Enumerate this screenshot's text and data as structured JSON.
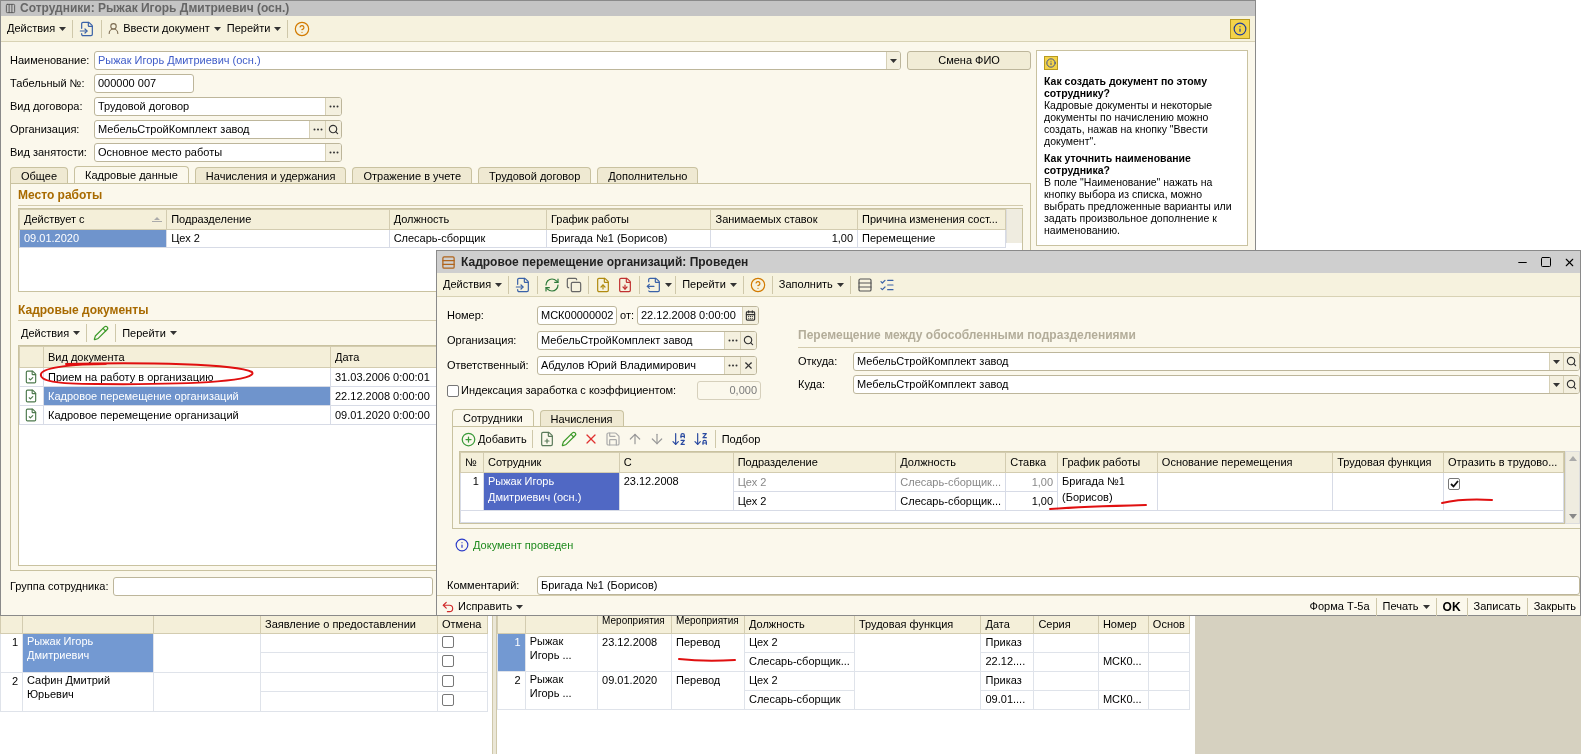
{
  "employee_window": {
    "title": "Сотрудники: Рыжак Игорь Дмитриевич (осн.)",
    "toolbar": {
      "actions": "Действия",
      "enter_document": "Ввести документ",
      "go": "Перейти"
    },
    "fields": [
      {
        "kind": "name",
        "label": "Наименование:",
        "value": "Рыжак Игорь Дмитриевич (осн.)"
      },
      {
        "kind": "plain",
        "label": "Табельный №:",
        "value": "000000 007"
      },
      {
        "kind": "select",
        "label": "Вид договора:",
        "value": "Трудовой договор"
      },
      {
        "kind": "lookup",
        "label": "Организация:",
        "value": "МебельСтройКомплект завод"
      },
      {
        "kind": "select",
        "label": "Вид занятости:",
        "value": "Основное место работы"
      }
    ],
    "rename_button": "Смена ФИО",
    "tabs": [
      {
        "label": "Общее",
        "selected": false
      },
      {
        "label": "Кадровые данные",
        "selected": true
      },
      {
        "label": "Начисления и удержания",
        "selected": false
      },
      {
        "label": "Отражение в учете",
        "selected": false
      },
      {
        "label": "Трудовой договор",
        "selected": false
      },
      {
        "label": "Дополнительно",
        "selected": false
      }
    ],
    "workplace": {
      "title": "Место работы",
      "columns": [
        "Действует с",
        "Подразделение",
        "Должность",
        "График работы",
        "Занимаемых ставок",
        "Причина изменения сост..."
      ],
      "rows": [
        {
          "selected": true,
          "cells": [
            "09.01.2020",
            "Цех 2",
            "Слесарь-сборщик",
            "Бригада №1 (Борисов)",
            "1,00",
            "Перемещение"
          ]
        }
      ]
    },
    "hr_documents": {
      "title": "Кадровые документы",
      "toolbar": {
        "actions": "Действия",
        "go": "Перейти"
      },
      "columns": [
        "Вид документа",
        "Дата"
      ],
      "rows": [
        {
          "type": "Прием на работу в организацию",
          "date": "31.03.2006 0:00:01",
          "selected": false
        },
        {
          "type": "Кадровое перемещение организаций",
          "date": "22.12.2008 0:00:00",
          "selected": true
        },
        {
          "type": "Кадровое перемещение организаций",
          "date": "09.01.2020 0:00:00",
          "selected": false
        }
      ]
    },
    "group_field": {
      "label": "Группа сотрудника:"
    },
    "help": [
      {
        "question": "Как создать документ по этому сотруднику?",
        "answer": "Кадровые документы и некоторые документы по начислению можно создать, нажав на кнопку \"Ввести документ\"."
      },
      {
        "question": "Как уточнить наименование сотрудника?",
        "answer": "В поле \"Наименование\" нажать на кнопку выбора из списка, можно выбрать предложенные варианты или задать произвольное дополнение к наименованию."
      }
    ]
  },
  "transfer_window": {
    "title": "Кадровое перемещение организаций: Проведен",
    "toolbar": {
      "actions": "Действия",
      "go": "Перейти",
      "fill": "Заполнить"
    },
    "number": {
      "label": "Номер:",
      "value": "МСК00000002",
      "date_label": "от:",
      "date": "22.12.2008  0:00:00"
    },
    "organization": {
      "label": "Организация:",
      "value": "МебельСтройКомплект завод"
    },
    "responsible": {
      "label": "Ответственный:",
      "value": "Абдулов Юрий Владимирович"
    },
    "indexation": {
      "label": "Индексация заработка с коэффициентом:",
      "checked": false,
      "value": "0,000"
    },
    "heading": "Перемещение между обособленными подразделениями",
    "from": {
      "label": "Откуда:",
      "value": "МебельСтройКомплект завод"
    },
    "to": {
      "label": "Куда:",
      "value": "МебельСтройКомплект завод"
    },
    "tabs": [
      {
        "label": "Сотрудники",
        "selected": true
      },
      {
        "label": "Начисления",
        "selected": false
      }
    ],
    "table_toolbar": {
      "add": "Добавить",
      "pick": "Подбор"
    },
    "table": {
      "columns": [
        "№",
        "Сотрудник",
        "С",
        "Подразделение",
        "Должность",
        "Ставка",
        "График работы",
        "Основание перемещения",
        "Трудовая функция",
        "Отразить в трудово..."
      ],
      "rows": [
        {
          "number": "1",
          "employee": "Рыжак Игорь Дмитриевич (осн.)",
          "selected": true,
          "date": "23.12.2008",
          "old_department": "Цех 2",
          "new_department": "Цех 2",
          "old_position": "Слесарь-сборщик...",
          "new_position": "Слесарь-сборщик...",
          "old_rate": "1,00",
          "new_rate": "1,00",
          "schedule": "Бригада №1 (Борисов)",
          "record_in_workbook": true
        }
      ]
    },
    "status": "Документ проведен",
    "comment": {
      "label": "Комментарий:",
      "value": "Бригада №1 (Борисов)"
    },
    "footer": {
      "fix": "Исправить",
      "form": "Форма Т-5а",
      "print": "Печать",
      "ok": "OK",
      "save": "Записать",
      "close": "Закрыть"
    }
  },
  "background_window": {
    "left_table": {
      "columns": [
        "Заявление о предоставлении",
        "Отмена"
      ],
      "rows": [
        {
          "number": "1",
          "employee": "Рыжак Игорь Дмитриевич",
          "selected": true,
          "cancel": [
            {
              "checked": false
            },
            {
              "checked": false
            }
          ]
        },
        {
          "number": "2",
          "employee": "Сафин Дмитрий Юрьевич",
          "selected": false,
          "cancel": [
            {
              "checked": false
            },
            {
              "checked": false
            }
          ]
        }
      ]
    },
    "right_table": {
      "columns": [
        "Мероприятия",
        "Мероприятия",
        "Должность",
        "Трудовая функция",
        "Дата",
        "Серия",
        "Номер",
        "Основ"
      ],
      "rows": [
        {
          "number": "1",
          "employee": "Рыжак Игорь ...",
          "selected": true,
          "date": "23.12.2008",
          "event": "Перевод",
          "department": "Цех 2",
          "position": "Слесарь-сборщик...",
          "doc_type": "Приказ",
          "doc_date": "22.12....",
          "doc_number": "МСК0..."
        },
        {
          "number": "2",
          "employee": "Рыжак Игорь ...",
          "selected": false,
          "date": "09.01.2020",
          "event": "Перевод",
          "department": "Цех 2",
          "position": "Слесарь-сборщик",
          "doc_type": "Приказ",
          "doc_date": "09.01....",
          "doc_number": "МСК0..."
        }
      ]
    }
  }
}
